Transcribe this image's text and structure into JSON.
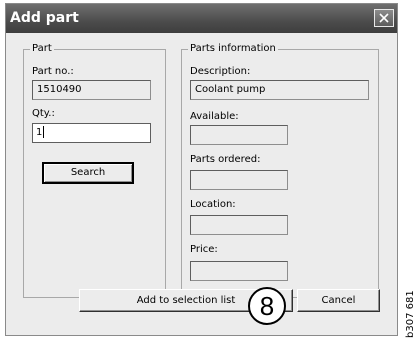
{
  "window": {
    "title": "Add part",
    "close_label": "close"
  },
  "part_group": {
    "legend": "Part",
    "part_no_label": "Part no.:",
    "part_no_value": "1510490",
    "qty_label": "Qty.:",
    "qty_value": "1",
    "search_label": "Search"
  },
  "info_group": {
    "legend": "Parts information",
    "description_label": "Description:",
    "description_value": "Coolant pump",
    "available_label": "Available:",
    "available_value": "",
    "ordered_label": "Parts ordered:",
    "ordered_value": "",
    "location_label": "Location:",
    "location_value": "",
    "price_label": "Price:",
    "price_value": ""
  },
  "footer": {
    "add_label": "Add to selection list",
    "cancel_label": "Cancel"
  },
  "annotations": {
    "callout_number": "8",
    "figure_code": "b307 681"
  }
}
